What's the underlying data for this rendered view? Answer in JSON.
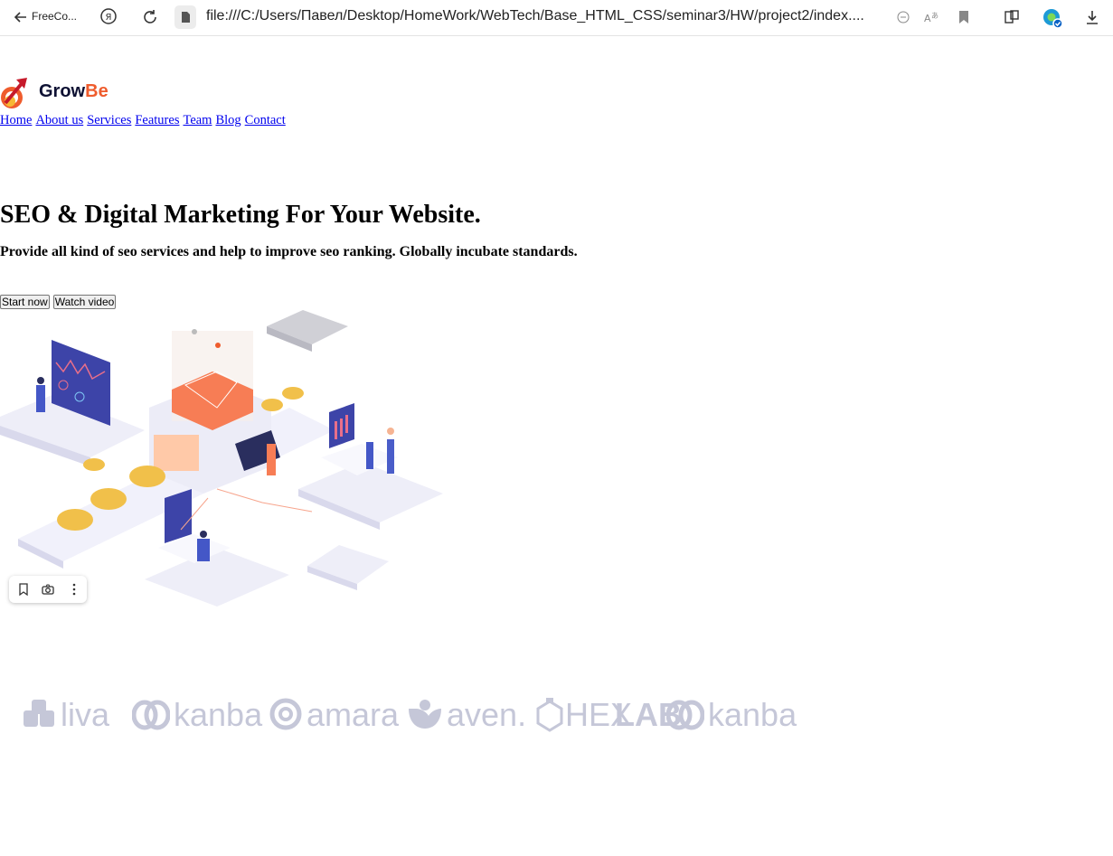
{
  "browser": {
    "tab_label": "FreeCo...",
    "url": "file:///C:/Users/Павел/Desktop/HomeWork/WebTech/Base_HTML_CSS/seminar3/HW/project2/index...."
  },
  "logo": {
    "grow": "Grow",
    "be": "Be"
  },
  "nav": [
    "Home",
    "About us",
    "Services",
    "Features",
    "Team",
    "Blog",
    "Contact"
  ],
  "hero": {
    "title": "SEO & Digital Marketing For Your Website.",
    "subtitle": "Provide all kind of seo services and help to improve seo ranking. Globally incubate standards.",
    "start_label": "Start now",
    "video_label": "Watch video"
  },
  "brands": [
    "liva",
    "kanba",
    "amara",
    "aven.",
    "HEX",
    "LAB",
    "kanba"
  ],
  "colors": {
    "brand_orange": "#ef5c2d",
    "brand_dark": "#0e1133",
    "logo_gray": "#c5c7d8",
    "link": "#0000ee"
  }
}
